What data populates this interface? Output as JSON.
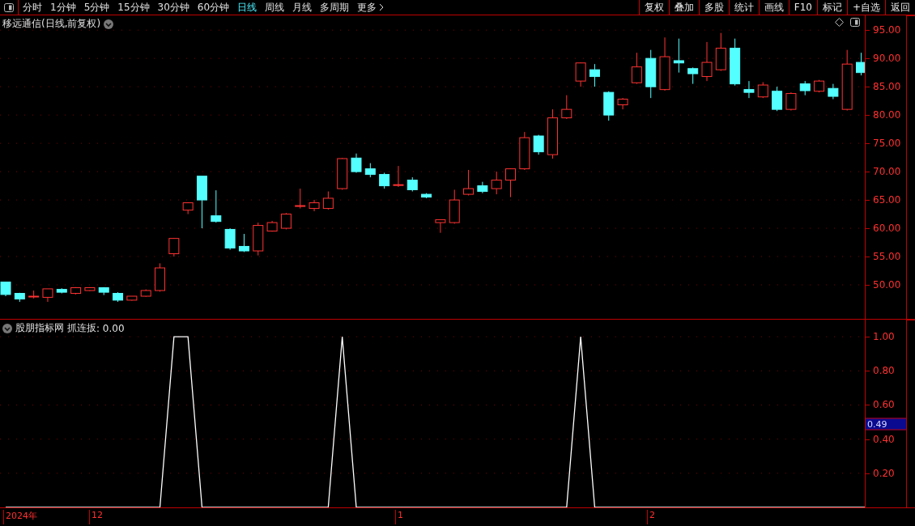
{
  "toolbar": {
    "periods": [
      {
        "label": "分时",
        "selected": false
      },
      {
        "label": "1分钟",
        "selected": false
      },
      {
        "label": "5分钟",
        "selected": false
      },
      {
        "label": "15分钟",
        "selected": false
      },
      {
        "label": "30分钟",
        "selected": false
      },
      {
        "label": "60分钟",
        "selected": false
      },
      {
        "label": "日线",
        "selected": true
      },
      {
        "label": "周线",
        "selected": false
      },
      {
        "label": "月线",
        "selected": false
      },
      {
        "label": "多周期",
        "selected": false
      },
      {
        "label": "更多",
        "selected": false,
        "kind": "more"
      }
    ],
    "actions": [
      "复权",
      "叠加",
      "多股",
      "统计",
      "画线",
      "F10",
      "标记",
      "+自选",
      "返回"
    ]
  },
  "main_chart": {
    "title": "移远通信(日线,前复权)",
    "chart_data": {
      "type": "candlestick",
      "grid": true,
      "ohlc": [
        [
          50.5,
          50.5,
          48,
          48.3
        ],
        [
          48.5,
          48.6,
          47,
          47.5
        ],
        [
          48,
          49,
          47.6,
          48
        ],
        [
          47.8,
          49.3,
          47,
          49.3
        ],
        [
          49.2,
          49.4,
          48.5,
          48.7
        ],
        [
          48.5,
          49.6,
          48.3,
          49.5
        ],
        [
          49,
          49.6,
          48.9,
          49.5
        ],
        [
          49.5,
          49.6,
          48.2,
          48.7
        ],
        [
          48.5,
          48.7,
          47,
          47.3
        ],
        [
          47.3,
          48,
          47.2,
          48
        ],
        [
          48,
          49.2,
          47.9,
          49
        ],
        [
          49,
          53.8,
          48.8,
          53
        ],
        [
          55.5,
          58.3,
          55,
          58.2
        ],
        [
          63.2,
          64.6,
          62.5,
          64.5
        ],
        [
          69.2,
          69.2,
          60,
          65
        ],
        [
          62.2,
          66.7,
          61,
          61.2
        ],
        [
          59.8,
          60,
          56.2,
          56.5
        ],
        [
          56.8,
          59,
          55.8,
          56
        ],
        [
          56,
          61,
          55.2,
          60.5
        ],
        [
          59.5,
          61.3,
          59.4,
          61
        ],
        [
          60,
          62.7,
          59.8,
          62.5
        ],
        [
          64,
          67,
          63.5,
          64
        ],
        [
          63.5,
          65,
          63,
          64.5
        ],
        [
          63.5,
          66.5,
          63.3,
          65.3
        ],
        [
          67,
          72.4,
          66.8,
          72.3
        ],
        [
          72.4,
          73.2,
          69.8,
          70
        ],
        [
          70.5,
          71.5,
          69,
          69.5
        ],
        [
          69.5,
          69.8,
          67,
          67.5
        ],
        [
          67.7,
          71,
          67.3,
          67.7
        ],
        [
          68.5,
          69,
          66.5,
          66.8
        ],
        [
          66,
          66.2,
          65.3,
          65.5
        ],
        [
          61,
          61.5,
          59.2,
          61.5
        ],
        [
          61,
          66.8,
          60.8,
          65
        ],
        [
          66,
          70.3,
          65.8,
          67
        ],
        [
          67.5,
          68.2,
          66.2,
          66.5
        ],
        [
          67,
          70,
          66,
          68.5
        ],
        [
          68.5,
          70.6,
          65.5,
          70.5
        ],
        [
          70.5,
          77,
          70.3,
          76
        ],
        [
          76.3,
          76.5,
          73,
          73.5
        ],
        [
          73,
          81,
          72.3,
          79.5
        ],
        [
          79.5,
          83.5,
          79.3,
          81
        ],
        [
          86,
          89.3,
          85,
          89.2
        ],
        [
          88,
          89,
          85,
          86.8
        ],
        [
          84,
          84.2,
          79,
          80
        ],
        [
          81.8,
          83,
          81,
          82.8
        ],
        [
          85.7,
          91,
          85.5,
          88.5
        ],
        [
          90,
          91.5,
          83,
          85
        ],
        [
          84.5,
          93.7,
          84.3,
          90.3
        ],
        [
          89.6,
          93.5,
          87.5,
          89.2
        ],
        [
          88.2,
          88.4,
          85.5,
          87.3
        ],
        [
          86.8,
          92.9,
          86,
          89.3
        ],
        [
          88,
          94.5,
          87.8,
          91.8
        ],
        [
          91.8,
          93.5,
          85.2,
          85.5
        ],
        [
          84.5,
          86,
          83,
          84
        ],
        [
          83.2,
          85.8,
          83,
          85.3
        ],
        [
          84.2,
          85,
          80.7,
          81
        ],
        [
          81,
          84,
          80.8,
          83.8
        ],
        [
          85.5,
          86,
          83.5,
          84.3
        ],
        [
          84.2,
          86.2,
          84,
          86
        ],
        [
          84.7,
          85.5,
          82.8,
          83.3
        ],
        [
          81,
          91.5,
          80.8,
          89
        ],
        [
          89.3,
          91,
          87,
          87.5
        ]
      ],
      "ylim": [
        44,
        97.6
      ],
      "yticks": [
        {
          "value": 95,
          "label": "95.00"
        },
        {
          "value": 90,
          "label": "90.00"
        },
        {
          "value": 85,
          "label": "85.00"
        },
        {
          "value": 80,
          "label": "80.00"
        },
        {
          "value": 75,
          "label": "75.00"
        },
        {
          "value": 70,
          "label": "70.00"
        },
        {
          "value": 65,
          "label": "65.00"
        },
        {
          "value": 60,
          "label": "60.00"
        },
        {
          "value": 55,
          "label": "55.00"
        },
        {
          "value": 50,
          "label": "50.00"
        }
      ]
    }
  },
  "indicator": {
    "name": "股朋指标网",
    "reading": ": 0.00",
    "cursor_value": "0.49",
    "chart_data": {
      "type": "line",
      "grid": true,
      "series": [
        {
          "name": "抓连扳",
          "color": "#ffffff",
          "values": [
            0,
            0,
            0,
            0,
            0,
            0,
            0,
            0,
            0,
            0,
            0,
            0,
            1,
            1,
            0,
            0,
            0,
            0,
            0,
            0,
            0,
            0,
            0,
            0,
            1,
            0,
            0,
            0,
            0,
            0,
            0,
            0,
            0,
            0,
            0,
            0,
            0,
            0,
            0,
            0,
            0,
            1,
            0,
            0,
            0,
            0,
            0,
            0,
            0,
            0,
            0,
            0,
            0,
            0,
            0,
            0,
            0,
            0,
            0,
            0,
            0,
            0
          ]
        }
      ],
      "ylim": [
        0,
        1.1
      ],
      "yticks": [
        {
          "value": 1,
          "label": "1.00"
        },
        {
          "value": 0.8,
          "label": "0.80"
        },
        {
          "value": 0.6,
          "label": "0.60"
        },
        {
          "value": 0.4,
          "label": "0.40"
        },
        {
          "value": 0.2,
          "label": "0.20"
        }
      ]
    }
  },
  "time_axis": [
    "2024年",
    "12",
    "1",
    "2"
  ]
}
